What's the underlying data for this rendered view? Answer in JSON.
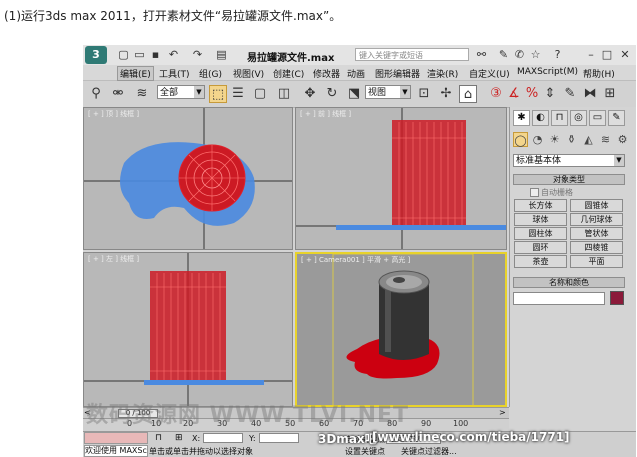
{
  "caption": "(1)运行3ds max 2011，打开素材文件“易拉罐源文件.max”。",
  "titlebar": {
    "logo": "3",
    "title": "易拉罐源文件.max",
    "search_placeholder": "键入关键字或短语",
    "help_label": "?"
  },
  "menu": [
    "编辑(E)",
    "工具(T)",
    "组(G)",
    "视图(V)",
    "创建(C)",
    "修改器",
    "动画",
    "图形编辑器",
    "渲染(R)",
    "自定义(U)",
    "MAXScript(M)",
    "帮助(H)"
  ],
  "toolbar": {
    "selection_filter": "全部",
    "ref_coord": "视图"
  },
  "viewports": {
    "top_label": "[ + ] 顶 ] 线框 ]",
    "front_label": "[ + ] 前 ] 线框 ]",
    "left_label": "[ + ] 左 ] 线框 ]",
    "camera_label": "[ + ] Camera001 ] 平滑 + 高光 ]"
  },
  "colors": {
    "can_wire": "#e0202a",
    "liquid": "#4a8ae0",
    "liquid_red": "#cc0010",
    "active_border": "#e8d22a",
    "viewport_bg": "#b8b8b8",
    "object_color": "#8b1a3a"
  },
  "command_panel": {
    "category": "标准基本体",
    "object_type_header": "对象类型",
    "autogrid": "自动栅格",
    "objects": [
      "长方体",
      "圆锥体",
      "球体",
      "几何球体",
      "圆柱体",
      "管状体",
      "圆环",
      "四棱锥",
      "茶壶",
      "平面"
    ],
    "name_color_header": "名称和颜色"
  },
  "timeline": {
    "frame_indicator": "0 / 100",
    "ticks": [
      "0",
      "10",
      "20",
      "30",
      "40",
      "50",
      "60",
      "70",
      "80",
      "90",
      "100"
    ]
  },
  "status": {
    "listener": "欢迎使用 MAXSc",
    "prompt": "单击或单击并拖动以选择对象",
    "x_label": "X:",
    "y_label": "Y:",
    "autokey": "自动关键点",
    "set_key": "设置关键点",
    "key_filter_label": "关键点过滤器...",
    "key_select": "选定对象"
  },
  "watermarks": {
    "forum": "数码资源网 WWW.TLVI.NET",
    "brand": "3Dmax吧",
    "url": "[www.lineco.com/tieba/1771]"
  }
}
